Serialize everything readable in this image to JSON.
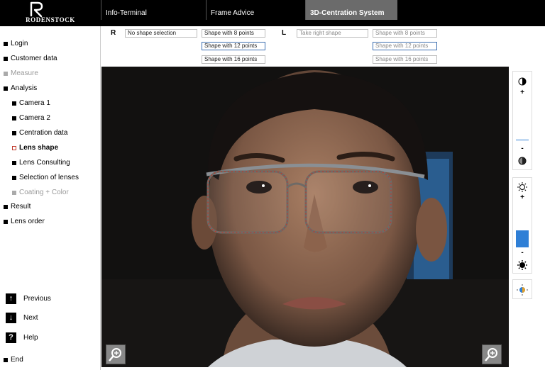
{
  "app": {
    "brand": "RODENSTOCK",
    "tabs": [
      {
        "label": "Info-Terminal"
      },
      {
        "label": "Frame Advice"
      },
      {
        "label": "3D-Centration System"
      }
    ]
  },
  "sidebar": {
    "items": [
      {
        "label": "Login"
      },
      {
        "label": "Customer data"
      },
      {
        "label": "Measure"
      },
      {
        "label": "Analysis"
      },
      {
        "label": "Camera 1"
      },
      {
        "label": "Camera 2"
      },
      {
        "label": "Centration data"
      },
      {
        "label": "Lens shape"
      },
      {
        "label": "Lens Consulting"
      },
      {
        "label": "Selection of lenses"
      },
      {
        "label": "Coating + Color"
      },
      {
        "label": "Result"
      },
      {
        "label": "Lens order"
      }
    ],
    "actions": {
      "previous": "Previous",
      "next": "Next",
      "help": "Help",
      "end": "End"
    }
  },
  "shape_selection": {
    "right": {
      "side_label": "R",
      "current": "No shape selection",
      "options": [
        "Shape with 8 points",
        "Shape with 12 points",
        "Shape with 16 points"
      ]
    },
    "left": {
      "side_label": "L",
      "current": "Take right shape",
      "options": [
        "Shape with 8 points",
        "Shape with 12 points",
        "Shape with 16 points"
      ]
    }
  },
  "right_panel": {
    "contrast_plus": "+",
    "contrast_minus": "-",
    "brightness_plus": "+",
    "brightness_minus": "-",
    "brightness_level": 0.4
  },
  "colors": {
    "accent_blue": "#2f7fd6",
    "shape_outline": "#c0392b",
    "active_tab": "#6b6b6b"
  }
}
